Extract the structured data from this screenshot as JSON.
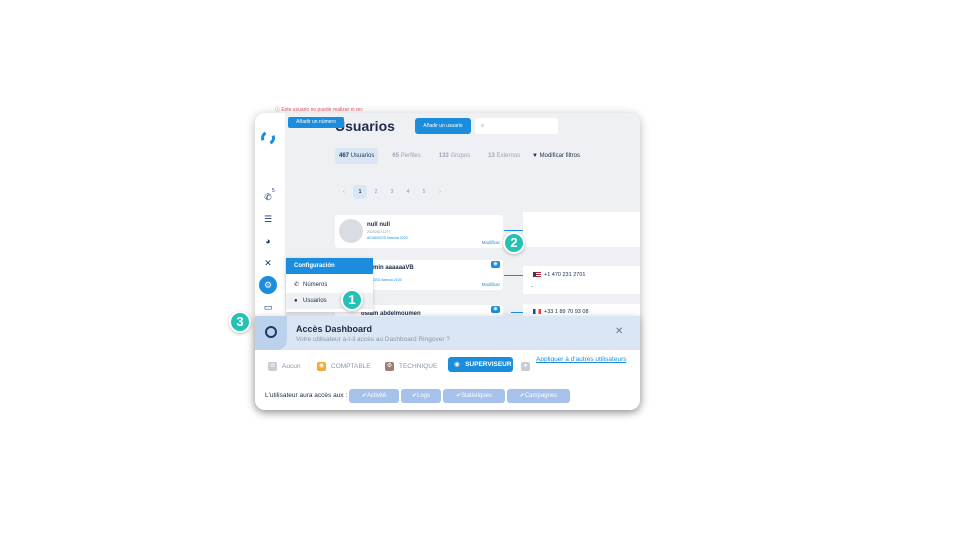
{
  "main": {
    "title": "Usuarios",
    "add_user_label": "Añadir un usuario",
    "tabs": [
      {
        "count": "467",
        "label": "Usuarios"
      },
      {
        "count": "65",
        "label": "Perfiles"
      },
      {
        "count": "133",
        "label": "Grupos"
      },
      {
        "count": "13",
        "label": "Externos"
      }
    ],
    "filter_label": "Modificar filtros",
    "pager": [
      "‹",
      "1",
      "2",
      "3",
      "4",
      "5",
      "›"
    ]
  },
  "sidebar": {
    "badge": "5",
    "active_icon": "gear-icon"
  },
  "users": [
    {
      "name": "null null",
      "id": "202026271277",
      "license": "ADVANCED licencia 2023",
      "modify": "Modificar"
    },
    {
      "name": "enjamin aaaaaaVB",
      "id": "202611",
      "license": "ADVANCED licencia 2023",
      "modify": "Modificar"
    },
    {
      "name": "osiam abdelmoumen"
    }
  ],
  "panels": {
    "error": "Este usuario no puede realizar ni rec",
    "add_number_label": "Añadir un número",
    "phone1": "+1 470 231 2701",
    "dash": "-",
    "phone2": "+33 1 89 70 93 08"
  },
  "config_menu": {
    "title": "Configuración",
    "items": [
      "Números",
      "Usuarios"
    ]
  },
  "dashboard": {
    "title": "Accès Dashboard",
    "subtitle": "Votre utilisateur a-t-il accès au Dashboard Ringover ?",
    "roles": [
      "Aucun",
      "COMPTABLE",
      "TECHNIQUE",
      "SUPERVISEUR"
    ],
    "apply_label": "Appliquer à d'autres utilisateurs",
    "access_label": "L'utilisateur aura accès aux :",
    "chips": [
      "Activité",
      "Logs",
      "Statistiques",
      "Campagnes"
    ]
  },
  "steps": [
    "1",
    "2",
    "3"
  ],
  "colors": {
    "accent": "#1c8ddc",
    "step": "#25c1b4",
    "error": "#e05463",
    "chip": "#a6c2ea"
  }
}
